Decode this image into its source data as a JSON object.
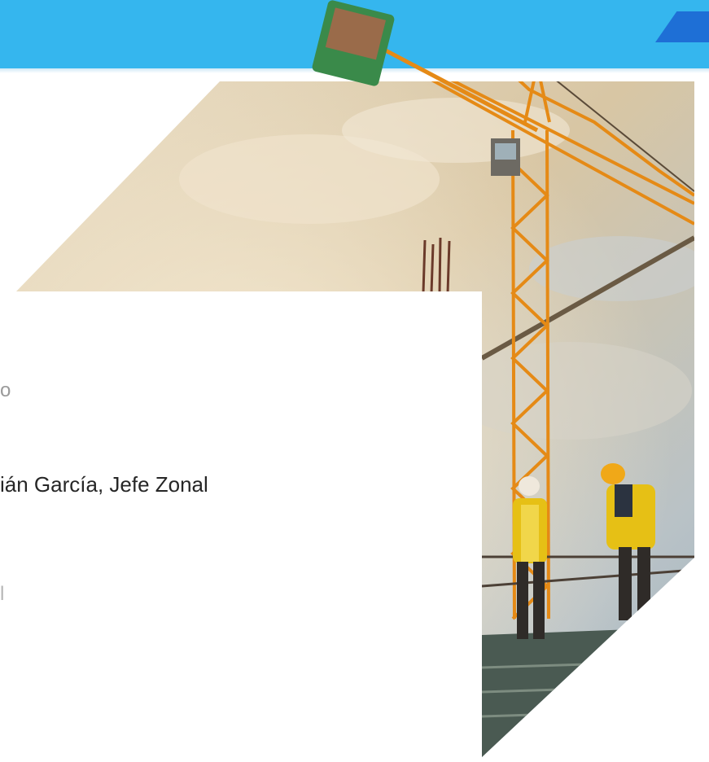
{
  "slide": {
    "line_1": "o",
    "line_2": "ián García, Jefe Zonal",
    "line_3": "l"
  },
  "colors": {
    "top_band": "#35b6ee",
    "accent": "#1e6fd6",
    "crane": "#e58a16",
    "sky": "#d8c6a4",
    "vest": "#f1c40f"
  }
}
